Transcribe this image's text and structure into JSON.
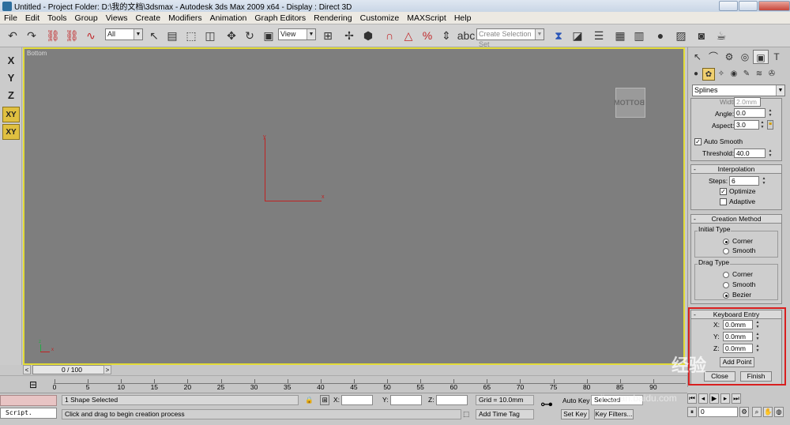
{
  "window": {
    "title": "Untitled     - Project Folder: D:\\我的文档\\3dsmax     - Autodesk 3ds Max  2009 x64         - Display : Direct 3D"
  },
  "menu": [
    "File",
    "Edit",
    "Tools",
    "Group",
    "Views",
    "Create",
    "Modifiers",
    "Animation",
    "Graph Editors",
    "Rendering",
    "Customize",
    "MAXScript",
    "Help"
  ],
  "toolbar": {
    "selection_filter": "All",
    "reference_coord": "View",
    "named_selection_placeholder": "Create Selection Set"
  },
  "axis_constraints": [
    "X",
    "Y",
    "Z",
    "XY",
    "XY"
  ],
  "viewport": {
    "label": "Bottom",
    "viewcube_label": "BOTTOM",
    "axis_x": "x",
    "axis_y": "y",
    "mini_x": "x",
    "mini_z": "z"
  },
  "command_panel": {
    "category": "Splines",
    "interp_params": {
      "width_label": "Width:",
      "width_value": "2.0mm",
      "angle_label": "Angle:",
      "angle_value": "0.0",
      "aspect_label": "Aspect:",
      "aspect_value": "3.0",
      "auto_smooth": "Auto Smooth",
      "threshold_label": "Threshold:",
      "threshold_value": "40.0"
    },
    "interpolation": {
      "title": "Interpolation",
      "steps_label": "Steps:",
      "steps_value": "6",
      "optimize": "Optimize",
      "adaptive": "Adaptive"
    },
    "creation_method": {
      "title": "Creation Method",
      "initial_type": "Initial Type",
      "initial_options": [
        "Corner",
        "Smooth"
      ],
      "drag_type": "Drag Type",
      "drag_options": [
        "Corner",
        "Smooth",
        "Bezier"
      ]
    },
    "keyboard_entry": {
      "title": "Keyboard Entry",
      "x_label": "X:",
      "x_value": "0.0mm",
      "y_label": "Y:",
      "y_value": "0.0mm",
      "z_label": "Z:",
      "z_value": "0.0mm",
      "add_point": "Add Point",
      "close": "Close",
      "finish": "Finish"
    }
  },
  "timeline": {
    "slider": "0 / 100",
    "ticks": [
      "0",
      "5",
      "10",
      "15",
      "20",
      "25",
      "30",
      "35",
      "40",
      "45",
      "50",
      "55",
      "60",
      "65",
      "70",
      "75",
      "80",
      "85",
      "90"
    ]
  },
  "status": {
    "script": "Script.",
    "selection_info": "1 Shape Selected",
    "prompt": "Click and drag to begin creation process",
    "x_label": "X:",
    "y_label": "Y:",
    "z_label": "Z:",
    "grid": "Grid = 10.0mm",
    "add_time_tag": "Add Time Tag"
  },
  "animation": {
    "auto_key": "Auto Key",
    "selected": "Selected",
    "set_key": "Set Key",
    "key_filters": "Key Filters...",
    "frame": "0"
  },
  "watermark": {
    "text": "经验",
    "url": "jingyan.baidu.com"
  }
}
